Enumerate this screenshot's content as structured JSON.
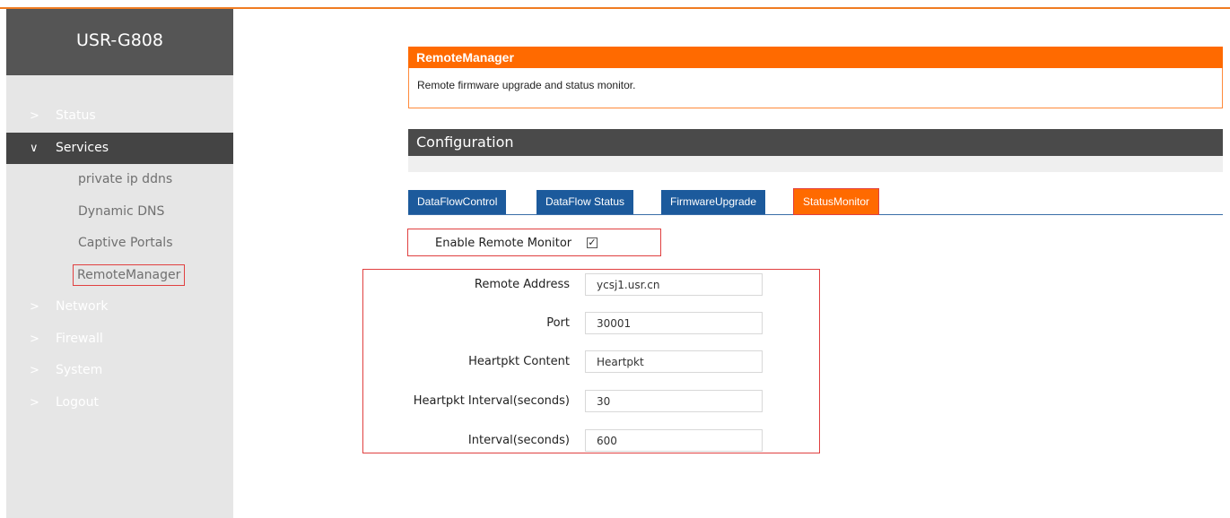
{
  "sidebar": {
    "brand": "USR-G808",
    "items": {
      "status": "Status",
      "services": "Services",
      "network": "Network",
      "firewall": "Firewall",
      "system": "System",
      "logout": "Logout"
    },
    "services_sub": {
      "private_ip_ddns": "private ip ddns",
      "dynamic_dns": "Dynamic DNS",
      "captive_portals": "Captive Portals",
      "remote_manager": "RemoteManager"
    }
  },
  "remote_manager": {
    "title": "RemoteManager",
    "description": "Remote firmware upgrade and status monitor."
  },
  "configuration": {
    "title": "Configuration"
  },
  "tabs": {
    "dataflow_control": "DataFlowControl",
    "dataflow_status": "DataFlow Status",
    "firmware_upgrade": "FirmwareUpgrade",
    "status_monitor": "StatusMonitor"
  },
  "form": {
    "enable_label": "Enable Remote Monitor",
    "enable_checked": "true",
    "remote_address_label": "Remote Address",
    "remote_address_value": "ycsj1.usr.cn",
    "port_label": "Port",
    "port_value": "30001",
    "heartpkt_content_label": "Heartpkt Content",
    "heartpkt_content_value": "Heartpkt",
    "heartpkt_interval_label": "Heartpkt Interval(seconds)",
    "heartpkt_interval_value": "30",
    "interval_label": "Interval(seconds)",
    "interval_value": "600"
  },
  "colors": {
    "accent": "#ff6a00",
    "tab_blue": "#1c5a9c",
    "sidebar_dark": "#444444",
    "highlight_red": "#e04040"
  }
}
